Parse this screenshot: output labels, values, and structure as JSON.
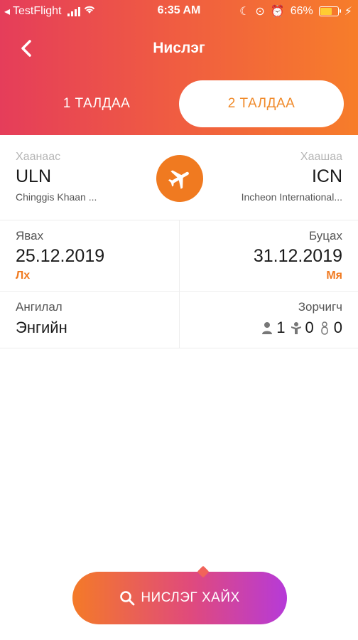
{
  "status_bar": {
    "carrier": "TestFlight",
    "time": "6:35 AM",
    "battery": "66%",
    "battery_level": 0.66
  },
  "navbar": {
    "title": "Нислэг"
  },
  "tabs": [
    {
      "label": "1 ТАЛДАА",
      "selected": false
    },
    {
      "label": "2 ТАЛДАА",
      "selected": true
    }
  ],
  "route": {
    "from_label": "Хаанаас",
    "from_code": "ULN",
    "from_airport": "Chinggis Khaan ...",
    "to_label": "Хаашаа",
    "to_code": "ICN",
    "to_airport": "Incheon International..."
  },
  "dates": {
    "depart_label": "Явах",
    "depart_date": "25.12.2019",
    "depart_day": "Лх",
    "return_label": "Буцах",
    "return_date": "31.12.2019",
    "return_day": "Мя"
  },
  "class": {
    "label": "Ангилал",
    "value": "Энгийн"
  },
  "passengers": {
    "label": "Зорчигч",
    "adults": "1",
    "children": "0",
    "infants": "0"
  },
  "search_button": {
    "label": "НИСЛЭГ ХАЙХ"
  },
  "colors": {
    "accent": "#f07a20",
    "header_start": "#e53d5a",
    "header_end": "#f77d2a",
    "button_end": "#b63ad8"
  }
}
